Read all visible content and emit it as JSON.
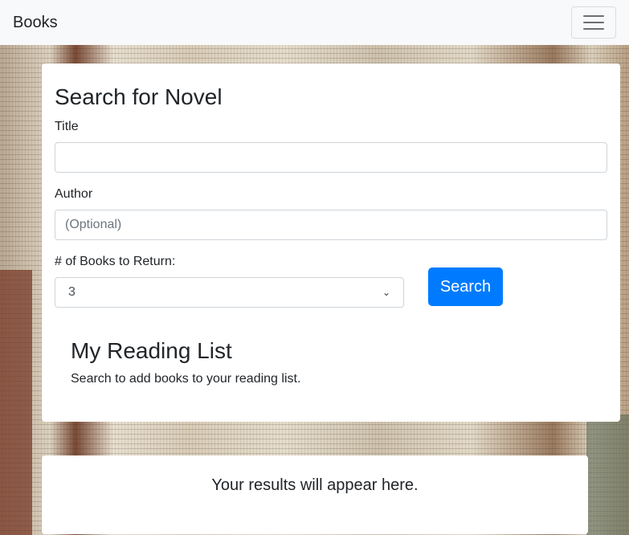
{
  "navbar": {
    "brand": "Books"
  },
  "search": {
    "heading": "Search for Novel",
    "title_label": "Title",
    "title_value": "",
    "title_placeholder": "",
    "author_label": "Author",
    "author_value": "",
    "author_placeholder": "(Optional)",
    "count_label": "# of Books to Return:",
    "count_selected": "3",
    "button_label": "Search"
  },
  "reading_list": {
    "heading": "My Reading List",
    "empty_text": "Search to add books to your reading list."
  },
  "results": {
    "placeholder_text": "Your results will appear here."
  },
  "colors": {
    "primary": "#007bff",
    "navbar_bg": "#f8f9fa"
  }
}
